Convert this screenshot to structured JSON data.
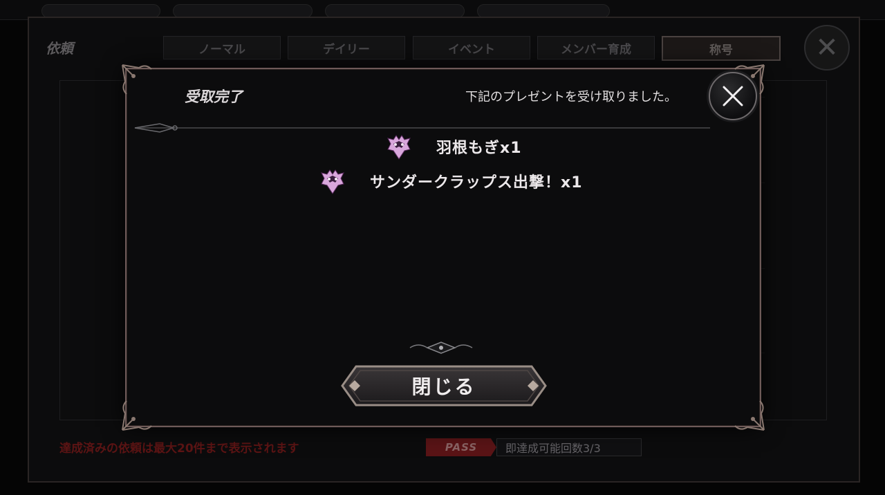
{
  "background": {
    "title": "依頼",
    "tabs": [
      {
        "label": "ノーマル"
      },
      {
        "label": "デイリー"
      },
      {
        "label": "イベント"
      },
      {
        "label": "メンバー育成"
      },
      {
        "label": "称号"
      }
    ],
    "footer_note": "達成済みの依頼は最大20件まで表示されます",
    "pass_badge": "PASS",
    "pass_count": "即達成可能回数3/3"
  },
  "modal": {
    "title": "受取完了",
    "message": "下記のプレゼントを受け取りました。",
    "rewards": [
      {
        "name": "羽根もぎx1",
        "icon": "crest-icon"
      },
      {
        "name": "サンダークラップス出撃！x1",
        "icon": "crest-icon"
      }
    ],
    "close_button_label": "閉じる"
  },
  "colors": {
    "frame_border": "#6e5a58",
    "reward_icon": "#e8b8e8",
    "footer_note": "#5c1414",
    "pass_badge": "#5a1416"
  }
}
